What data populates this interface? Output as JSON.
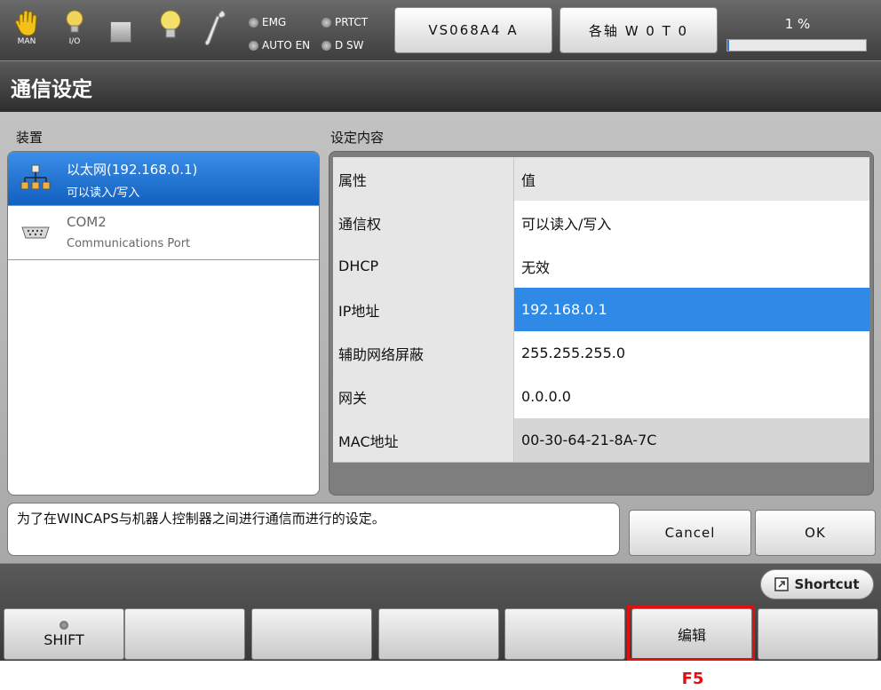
{
  "topbar": {
    "icons": [
      {
        "icon": "hand-icon",
        "caption": "MAN"
      },
      {
        "icon": "bulb-io-icon",
        "caption": "I/O"
      },
      {
        "icon": "square-icon",
        "caption": ""
      },
      {
        "icon": "bulb-icon",
        "caption": ""
      },
      {
        "icon": "wrench-icon",
        "caption": ""
      }
    ],
    "leds": [
      "EMG",
      "PRTCT",
      "AUTO EN",
      "D SW"
    ],
    "robot_button": "VS068A4 A",
    "axis_button": "各轴 W 0 T 0",
    "speed_percent": "1 %",
    "speed_value": 1
  },
  "title": "通信设定",
  "device_section_label": "装置",
  "content_section_label": "设定内容",
  "devices": [
    {
      "name": "以太网(192.168.0.1)",
      "sub": "可以读入/写入",
      "icon": "network-icon",
      "selected": true
    },
    {
      "name": "COM2",
      "sub": "Communications Port",
      "icon": "serial-port-icon",
      "selected": false
    }
  ],
  "properties": {
    "header": {
      "key": "属性",
      "value": "值"
    },
    "rows": [
      {
        "key": "通信权",
        "value": "可以读入/写入"
      },
      {
        "key": "DHCP",
        "value": "无效"
      },
      {
        "key": "IP地址",
        "value": "192.168.0.1"
      },
      {
        "key": "辅助网络屏蔽",
        "value": "255.255.255.0"
      },
      {
        "key": "网关",
        "value": "0.0.0.0"
      },
      {
        "key": "MAC地址",
        "value": "00-30-64-21-8A-7C"
      }
    ]
  },
  "description": "为了在WINCAPS与机器人控制器之间进行通信而进行的设定。",
  "buttons": {
    "cancel": "Cancel",
    "ok": "OK",
    "shortcut": "Shortcut"
  },
  "fkeys": [
    {
      "label": "SHIFT"
    },
    {
      "label": ""
    },
    {
      "label": ""
    },
    {
      "label": ""
    },
    {
      "label": ""
    },
    {
      "label": "编辑"
    },
    {
      "label": ""
    }
  ],
  "highlight_caption": "F5",
  "colors": {
    "accent": "#2e8ae6",
    "highlight": "#e01010"
  }
}
